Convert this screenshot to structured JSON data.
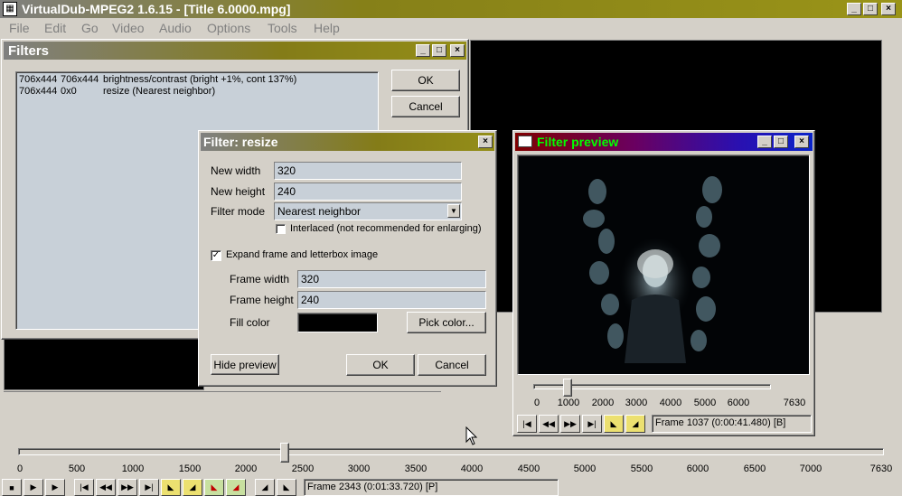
{
  "app": {
    "title": "VirtualDub-MPEG2 1.6.15 - [Title 6.0000.mpg]",
    "menu": [
      "File",
      "Edit",
      "Go",
      "Video",
      "Audio",
      "Options",
      "Tools",
      "Help"
    ]
  },
  "filters_window": {
    "title": "Filters",
    "list": [
      {
        "in": "706x444",
        "out": "706x444",
        "desc": "brightness/contrast (bright +1%, cont 137%)"
      },
      {
        "in": "706x444",
        "out": "0x0",
        "desc": "resize (Nearest neighbor)"
      }
    ],
    "ok_label": "OK",
    "cancel_label": "Cancel"
  },
  "resize_dialog": {
    "title": "Filter: resize",
    "new_width_label": "New width",
    "new_width": "320",
    "new_height_label": "New height",
    "new_height": "240",
    "filter_mode_label": "Filter mode",
    "filter_mode": "Nearest neighbor",
    "interlaced_label": "Interlaced (not recommended for enlarging)",
    "expand_label": "Expand frame and letterbox image",
    "frame_width_label": "Frame width",
    "frame_width": "320",
    "frame_height_label": "Frame height",
    "frame_height": "240",
    "fill_color_label": "Fill color",
    "fill_color": "#000000",
    "pick_color_label": "Pick color...",
    "hide_preview_label": "Hide preview",
    "ok_label": "OK",
    "cancel_label": "Cancel"
  },
  "preview_window": {
    "title": "Filter preview",
    "title_color": "#00ff00",
    "ticks": [
      "0",
      "1000",
      "2000",
      "3000",
      "4000",
      "5000",
      "6000",
      "7630"
    ],
    "slider_position": 0.135,
    "frame_status": "Frame 1037 (0:00:41.480) [B]"
  },
  "main_timeline": {
    "ticks": [
      "0",
      "500",
      "1000",
      "1500",
      "2000",
      "2500",
      "3000",
      "3500",
      "4000",
      "4500",
      "5000",
      "5500",
      "6000",
      "6500",
      "7000",
      "7630"
    ],
    "slider_position": 0.307,
    "frame_status": "Frame 2343 (0:01:33.720) [P]"
  }
}
